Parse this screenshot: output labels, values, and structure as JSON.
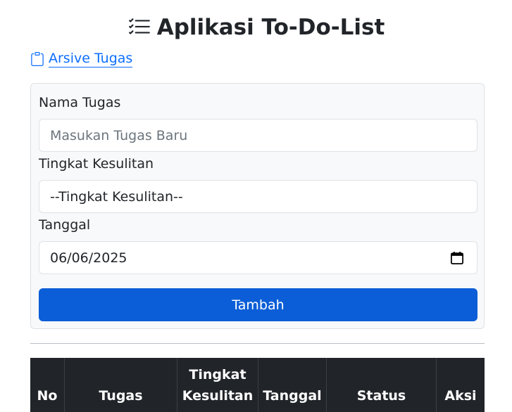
{
  "app": {
    "title": "Aplikasi To-Do-List",
    "title_icon": "list-check-icon"
  },
  "archive_link": {
    "label": "Arsive Tugas",
    "icon": "clipboard-icon"
  },
  "form": {
    "task_name_label": "Nama Tugas",
    "task_name_placeholder": "Masukan Tugas Baru",
    "task_name_value": "",
    "difficulty_label": "Tingkat Kesulitan",
    "difficulty_selected": "--Tingkat Kesulitan--",
    "date_label": "Tanggal",
    "date_value": "06/06/2025",
    "date_icon": "calendar-icon",
    "submit_label": "Tambah"
  },
  "table": {
    "headers": {
      "no": "No",
      "task": "Tugas",
      "difficulty_line1": "Tingkat",
      "difficulty_line2": "Kesulitan",
      "date": "Tanggal",
      "status": "Status",
      "action": "Aksi"
    }
  },
  "colors": {
    "primary": "#0d6efd",
    "button": "#0b5ed7",
    "table_head": "#212529",
    "card_bg": "#f8f9fa"
  }
}
